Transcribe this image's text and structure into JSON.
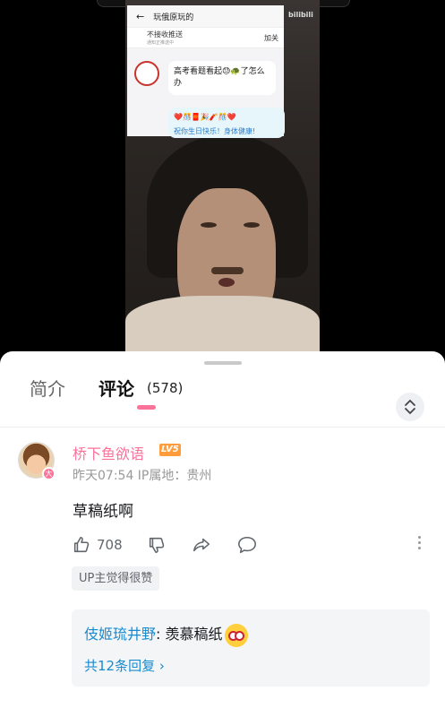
{
  "video": {
    "screenshot_title": "玩俄原玩的",
    "screenshot_bar_label": "不接收推送",
    "screenshot_bar_sub": "通知正推送中",
    "screenshot_bar_right": "加关",
    "screenshot_message": "高考看题看起😓🐢了怎么办",
    "screenshot_message2_line1": "❤️🎊🧧🎉🧨🎊❤️",
    "screenshot_message2_line2": "祝你生日快乐！身体健康!",
    "watermark": "bilibili"
  },
  "tabs": {
    "intro_label": "简介",
    "comments_label": "评论",
    "comments_count": "(578)"
  },
  "comment": {
    "username": "桥下鱼欲语",
    "level": "LV5",
    "avatar_badge": "大",
    "meta": "昨天07:54  IP属地：贵州",
    "text": "草稿纸啊",
    "like_count": "708",
    "up_badge": "UP主觉得很赞",
    "reply": {
      "name": "伎姬琉井野",
      "separator": ": ",
      "text": "羡慕稿纸",
      "more": "共12条回复 ›"
    }
  },
  "colors": {
    "accent": "#fb7299",
    "link": "#178bcf",
    "level": "#ff9c3c"
  }
}
